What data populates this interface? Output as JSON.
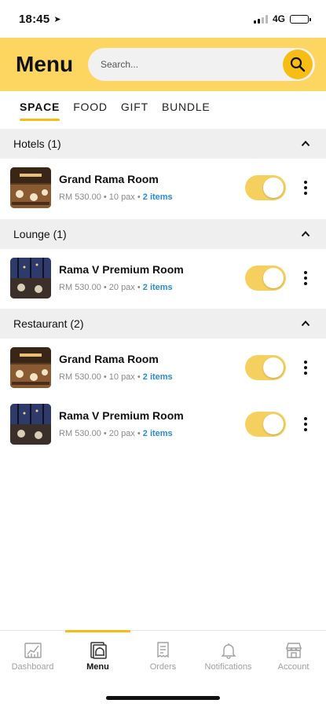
{
  "status_bar": {
    "time": "18:45",
    "network": "4G"
  },
  "header": {
    "title": "Menu",
    "search_placeholder": "Search..."
  },
  "tabs": [
    {
      "label": "SPACE",
      "active": true
    },
    {
      "label": "FOOD",
      "active": false
    },
    {
      "label": "GIFT",
      "active": false
    },
    {
      "label": "BUNDLE",
      "active": false
    }
  ],
  "sections": [
    {
      "title": "Hotels (1)",
      "items": [
        {
          "name": "Grand Rama Room",
          "meta": "RM 530.00 • 10 pax • ",
          "link": "2 items",
          "enabled": true,
          "thumb": "warm"
        }
      ]
    },
    {
      "title": "Lounge (1)",
      "items": [
        {
          "name": "Rama V Premium Room",
          "meta": "RM 530.00 • 20 pax • ",
          "link": "2 items",
          "enabled": true,
          "thumb": "night"
        }
      ]
    },
    {
      "title": "Restaurant (2)",
      "items": [
        {
          "name": "Grand Rama Room",
          "meta": "RM 530.00 • 10 pax • ",
          "link": "2 items",
          "enabled": true,
          "thumb": "warm"
        },
        {
          "name": "Rama V Premium Room",
          "meta": "RM 530.00 • 20 pax • ",
          "link": "2 items",
          "enabled": true,
          "thumb": "night"
        }
      ]
    }
  ],
  "bottom_nav": [
    {
      "label": "Dashboard",
      "icon": "chart-icon",
      "active": false
    },
    {
      "label": "Menu",
      "icon": "menu-book-icon",
      "active": true
    },
    {
      "label": "Orders",
      "icon": "receipt-icon",
      "active": false
    },
    {
      "label": "Notifications",
      "icon": "bell-icon",
      "active": false
    },
    {
      "label": "Account",
      "icon": "store-icon",
      "active": false
    }
  ],
  "colors": {
    "accent": "#F7BD14",
    "header_bg": "#FDD561",
    "toggle_on": "#F6D05E",
    "link": "#2a8bd8"
  }
}
